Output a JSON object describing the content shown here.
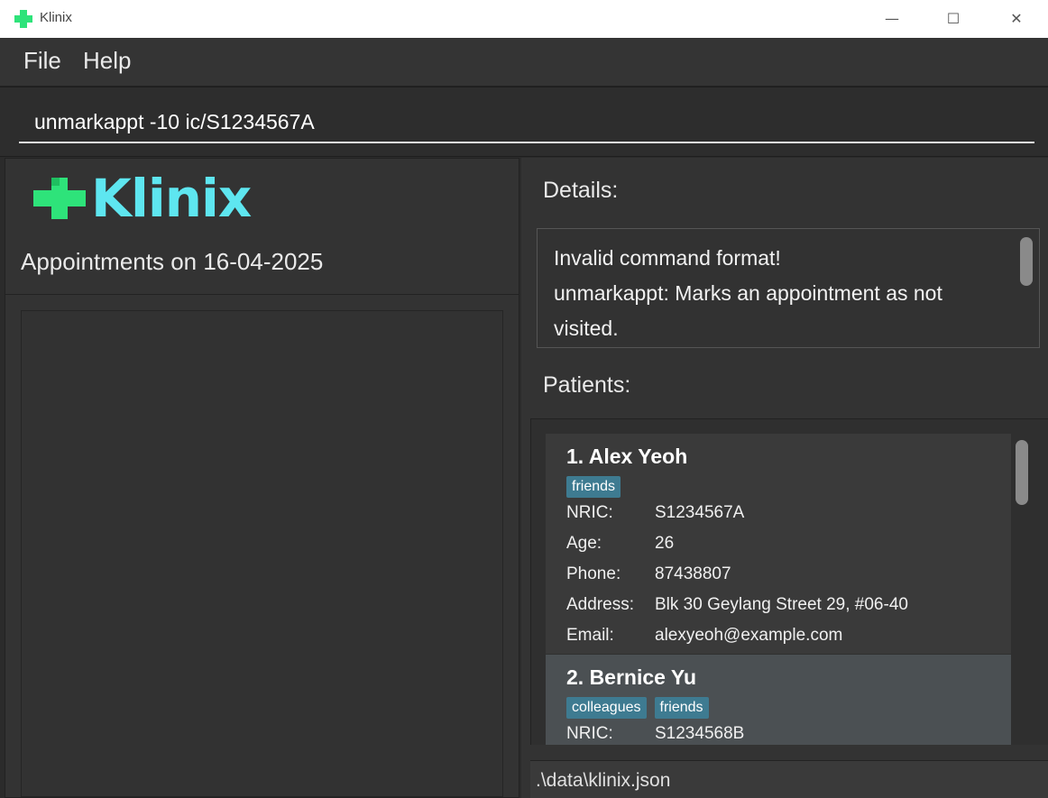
{
  "window": {
    "title": "Klinix",
    "minimize_glyph": "—",
    "maximize_glyph": "☐",
    "close_glyph": "✕"
  },
  "menu": {
    "file": "File",
    "help": "Help"
  },
  "command": {
    "value": "unmarkappt -10 ic/S1234567A"
  },
  "logo": {
    "text": "Klinix"
  },
  "appointments": {
    "title": "Appointments on 16-04-2025"
  },
  "details": {
    "label": "Details:",
    "lines": [
      "Invalid command format!",
      "unmarkappt: Marks an appointment as not",
      "visited."
    ]
  },
  "patients": {
    "label": "Patients:",
    "field_labels": {
      "nric": "NRIC:",
      "age": "Age:",
      "phone": "Phone:",
      "address": "Address:",
      "email": "Email:"
    },
    "items": [
      {
        "name": "1. Alex Yeoh",
        "tags": [
          "friends"
        ],
        "nric": "S1234567A",
        "age": "26",
        "phone": "87438807",
        "address": "Blk 30 Geylang Street 29, #06-40",
        "email": "alexyeoh@example.com"
      },
      {
        "name": "2. Bernice Yu",
        "tags": [
          "colleagues",
          "friends"
        ],
        "nric": "S1234568B"
      }
    ]
  },
  "status": {
    "file_path": ".\\data\\klinix.json"
  },
  "colors": {
    "accent_green": "#2ee37a",
    "accent_cyan": "#5ee6f0",
    "tag_bg": "#3e7b91",
    "background": "#2b2b2b"
  }
}
